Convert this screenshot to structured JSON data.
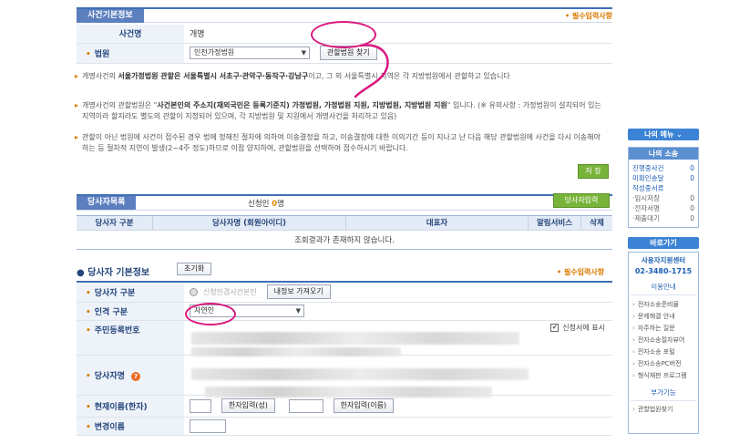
{
  "case_info": {
    "title": "사건기본정보",
    "required_note": "• 필수입력사항",
    "case_name_label": "사건명",
    "case_name_value": "개명",
    "court_label": "법원",
    "court_value": "인천가정법원",
    "court_find_button": "관할법원 찾기",
    "notes": [
      {
        "pre": "개명사건의 ",
        "bold": "서울가정법원 관할은 서울특별시 서초구·관악구·동작구·강남구",
        "post": "이고, 그 외 서울특별시 지역은 각 지방법원에서 관할하고 있습니다"
      },
      {
        "pre": "개명사건의 관할법원은 \"",
        "bold": "사건본인의 주소지(재외국민은 등록기준지) 가정법원, 가정법원 지원, 지방법원, 지방법원 지원",
        "post": "\" 입니다. (※ 유의사항 : 가정법원이 설치되어 있는 지역이라 할지라도 별도의 관할이 지정되어 있으며, 각 지방법원 및 지원에서 개명사건을 처리하고 있음)"
      },
      {
        "pre": "관할이 아닌 법원에 사건이 접수된 경우 법에 정해진 절차에 의하여 이송결정을 하고, 이송결정에 대한 이의기간 등이 지나고 난 다음 해당 관할법원에 사건을 다시 이송해야 하는 등 절차적 지연이 발생(2~4주 정도)하므로 이점 양지하여, 관할법원을 선택하여 접수하시기 바랍니다.",
        "bold": "",
        "post": ""
      }
    ],
    "save_button": "저 장"
  },
  "party_list": {
    "title": "당사자목록",
    "applicant_prefix": "신청인 ",
    "applicant_count": "0",
    "applicant_suffix": "명",
    "add_button": "당사자입력",
    "columns": [
      "당사자 구분",
      "당사자명 (회원아이디)",
      "대표자",
      "알림서비스",
      "삭제"
    ],
    "empty_message": "조회결과가 존재하지 않습니다."
  },
  "party_basic": {
    "title": "당사자 기본정보",
    "reset_button": "초기화",
    "required_note": "• 필수입력사항",
    "type_label": "당사자 구분",
    "type_radio_text": "신청인겸사건본인",
    "my_info_button": "내정보 가져오기",
    "person_type_label": "인격 구분",
    "person_type_value": "자연인",
    "rrn_label": "주민등록번호",
    "show_on_application": "신청서에 표시",
    "name_label": "당사자명",
    "current_name_label": "현재이름(한자)",
    "hanja_surname_button": "한자입력(성)",
    "hanja_name_button": "한자입력(이름)",
    "new_name_label": "변경이름"
  },
  "sidebar": {
    "my_menu": "나의 메뉴 ⌄",
    "my_case_title": "나의 소송",
    "rows": [
      {
        "label": "진행중사건",
        "count": "0",
        "style": "blue"
      },
      {
        "label": "미확인송달",
        "count": "0",
        "style": "blue"
      },
      {
        "label": "작성중서류",
        "count": "",
        "style": "blue"
      },
      {
        "label": "·임시저장",
        "count": "0",
        "style": "gray"
      },
      {
        "label": "·전자서명",
        "count": "0",
        "style": "gray"
      },
      {
        "label": "·제출대기",
        "count": "0",
        "style": "gray"
      }
    ],
    "shortcut_title": "바로가기",
    "support_center": "사용자지원센터",
    "phone": "02-3480-1715",
    "usage_title": "이용안내",
    "links": [
      "전자소송준비물",
      "문제해결 안내",
      "자주하는 질문",
      "전자소송절차뷰어",
      "전자소송 포털",
      "전자소송PC버전",
      "형식재판 프로그램"
    ],
    "extra_title": "부가기능",
    "extra_links": [
      "관할법원찾기"
    ]
  },
  "colors": {
    "accent": "#3f6fb5",
    "annotation": "#d9187f",
    "required": "#d97a00",
    "green": "#78b43a"
  }
}
